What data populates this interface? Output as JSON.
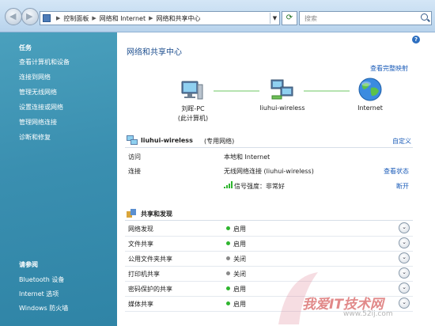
{
  "addressbar": {
    "breadcrumb": [
      "控制面板",
      "网络和 Internet",
      "网络和共享中心"
    ],
    "search_placeholder": "搜索"
  },
  "sidebar": {
    "tasks_title": "任务",
    "tasks": [
      "查看计算机和设备",
      "连接到网络",
      "管理无线网络",
      "设置连接或网络",
      "管理网络连接",
      "诊断和修复"
    ],
    "see_also_title": "请参阅",
    "see_also": [
      "Bluetooth 设备",
      "Internet 选项",
      "Windows 防火墙"
    ]
  },
  "main": {
    "title": "网络和共享中心",
    "full_map": "查看完整映射",
    "map": {
      "computer_name": "刘晖-PC",
      "computer_sub": "(此计算机)",
      "network_name": "liuhui-wireless",
      "internet": "Internet"
    },
    "network": {
      "name": "liuhui-wireless",
      "type": "(专用网络)",
      "customize": "自定义",
      "rows": [
        {
          "label": "访问",
          "value": "本地和 Internet",
          "link": ""
        },
        {
          "label": "连接",
          "value": "无线网络连接 (liuhui-wireless)",
          "link": "查看状态"
        }
      ],
      "signal": "信号强度：非常好",
      "disconnect": "断开"
    },
    "sharing": {
      "title": "共享和发现",
      "rows": [
        {
          "label": "网络发现",
          "status": "启用",
          "color": "#2fb52f"
        },
        {
          "label": "文件共享",
          "status": "启用",
          "color": "#2fb52f"
        },
        {
          "label": "公用文件夹共享",
          "status": "关闭",
          "color": "#8a8a8a"
        },
        {
          "label": "打印机共享",
          "status": "关闭",
          "color": "#8a8a8a"
        },
        {
          "label": "密码保护的共享",
          "status": "启用",
          "color": "#2fb52f"
        },
        {
          "label": "媒体共享",
          "status": "启用",
          "color": "#2fb52f"
        }
      ]
    }
  },
  "watermark": {
    "text": "我爱IT技术网",
    "url": "www.52ij.com"
  },
  "colors": {
    "link": "#1a5bb8",
    "title": "#1e4f8f",
    "sidebar": "#3a8fb0",
    "on": "#2fb52f",
    "off": "#8a8a8a"
  }
}
